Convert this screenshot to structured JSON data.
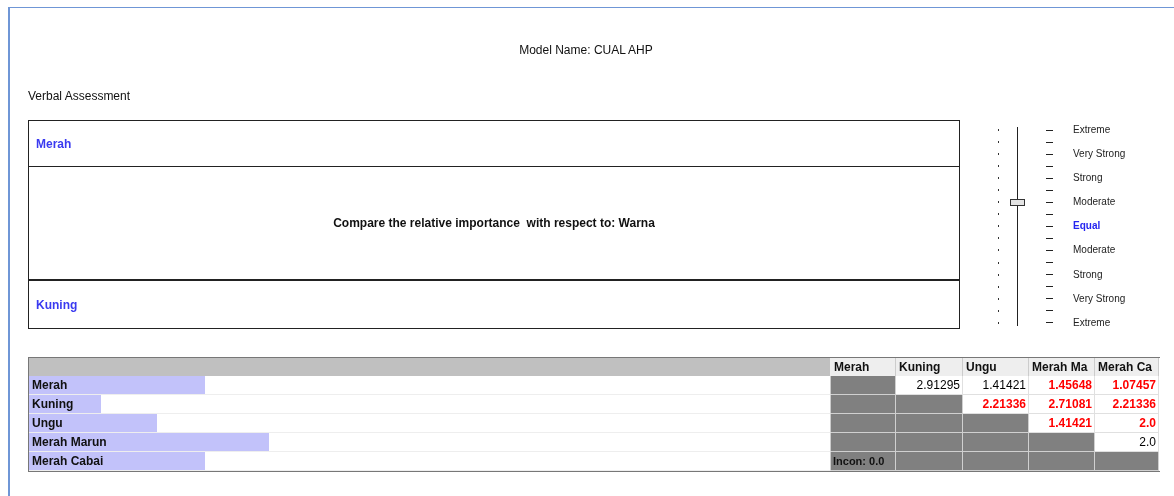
{
  "model_name": "Model Name: CUAL AHP",
  "section_title": "Verbal Assessment",
  "comparison": {
    "top": "Merah",
    "question": "Compare the relative importance  with respect to: Warna",
    "bottom": "Kuning"
  },
  "scale": {
    "level": 0.625,
    "labels": [
      {
        "text": "Extreme",
        "selected": false
      },
      {
        "text": "Very Strong",
        "selected": false
      },
      {
        "text": "Strong",
        "selected": false
      },
      {
        "text": "Moderate",
        "selected": false
      },
      {
        "text": "Equal",
        "selected": true
      },
      {
        "text": "Moderate",
        "selected": false
      },
      {
        "text": "Strong",
        "selected": false
      },
      {
        "text": "Very Strong",
        "selected": false
      },
      {
        "text": "Extreme",
        "selected": false
      }
    ]
  },
  "matrix": {
    "columns": [
      "Merah",
      "Kuning",
      "Ungu",
      "Merah Ma",
      "Merah Ca"
    ],
    "rows": [
      {
        "name": "Merah",
        "level": 0.22,
        "cells": [
          {
            "kind": "empty"
          },
          {
            "kind": "value",
            "text": "2.91295",
            "color": "#000000"
          },
          {
            "kind": "value",
            "text": "1.41421",
            "color": "#000000"
          },
          {
            "kind": "value",
            "text": "1.45648",
            "color": "#ff0000"
          },
          {
            "kind": "value",
            "text": "1.07457",
            "color": "#ff0000"
          }
        ]
      },
      {
        "name": "Kuning",
        "level": 0.09,
        "cells": [
          {
            "kind": "empty"
          },
          {
            "kind": "empty"
          },
          {
            "kind": "value",
            "text": "2.21336",
            "color": "#ff0000"
          },
          {
            "kind": "value",
            "text": "2.71081",
            "color": "#ff0000"
          },
          {
            "kind": "value",
            "text": "2.21336",
            "color": "#ff0000"
          }
        ]
      },
      {
        "name": "Ungu",
        "level": 0.16,
        "cells": [
          {
            "kind": "empty"
          },
          {
            "kind": "empty"
          },
          {
            "kind": "empty"
          },
          {
            "kind": "value",
            "text": "1.41421",
            "color": "#ff0000"
          },
          {
            "kind": "value",
            "text": "2.0",
            "color": "#ff0000"
          }
        ]
      },
      {
        "name": "Merah Marun",
        "level": 0.3,
        "cells": [
          {
            "kind": "empty"
          },
          {
            "kind": "empty"
          },
          {
            "kind": "empty"
          },
          {
            "kind": "empty"
          },
          {
            "kind": "value",
            "text": "2.0",
            "color": "#000000"
          }
        ]
      },
      {
        "name": "Merah Cabai",
        "level": 0.22,
        "cells": [
          {
            "kind": "label",
            "text": "Incon: 0.0"
          },
          {
            "kind": "empty"
          },
          {
            "kind": "empty"
          },
          {
            "kind": "empty"
          },
          {
            "kind": "empty"
          }
        ]
      }
    ]
  }
}
